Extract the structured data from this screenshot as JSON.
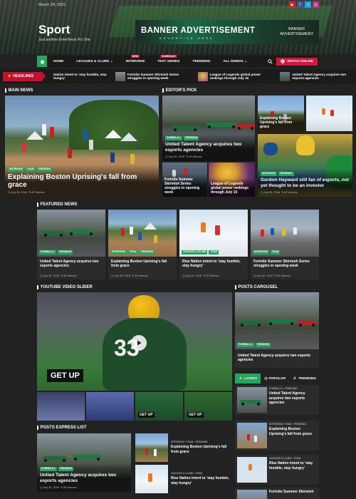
{
  "header": {
    "date": "March 18, 2021",
    "site_title": "Sport",
    "tagline": "Just another EnterNews Pro Site",
    "social_icons": [
      "youtube-icon",
      "facebook-icon",
      "twitter-icon",
      "instagram-icon"
    ],
    "banner": {
      "main_text": "BANNER ADVERTISEMENT",
      "sub_text": "ADVERTISE HERE",
      "side_text_line1": "BANNER",
      "side_text_line2": "ADVERTISEMENT"
    }
  },
  "nav": {
    "items": [
      {
        "label": "HOME",
        "tag": ""
      },
      {
        "label": "LEAGUES & CLUBS ⌄",
        "tag": ""
      },
      {
        "label": "INTERVIEW",
        "tag": "NEW"
      },
      {
        "label": "TEST SERIES",
        "tag": "SCHEDULE"
      },
      {
        "label": "TRENDING",
        "tag": ""
      },
      {
        "label": "ALL DEMOS ⌄",
        "tag": ""
      }
    ],
    "watch_online": "WATCH ONLINE"
  },
  "ticker": {
    "label": "HEADLINES",
    "items": [
      "Nation intent to 'stay humble, stay hungry'",
      "Fortnite Summer Skirmish Series struggles in opening week",
      "League of Legends global power rankings through July 16",
      "United Talent Agency acquires two esports agencies"
    ]
  },
  "main_news": {
    "heading": "MAIN NEWS",
    "categories": [
      "INTERVIEW",
      "TEAM",
      "TRENDING"
    ],
    "title": "Explaining Boston Uprising's fall from grace",
    "date": "July 30, 2018",
    "author": "AF themes"
  },
  "editors_pick": {
    "heading": "EDITOR'S PICK",
    "large": {
      "categories": [
        "FORMULA 1",
        "TRENDING"
      ],
      "title": "United Talent Agency acquires two esports agencies",
      "date": "July 30, 2018",
      "author": "AF themes"
    },
    "small": [
      {
        "title": "Explaining Boston Uprising's fall from grace"
      },
      {
        "title": "Fortnite Summer Skirmish Series struggles in opening week"
      },
      {
        "title": "League of Legends global power rankings through July 16"
      }
    ],
    "tall": {
      "categories": [
        "INTERVIEW",
        "TRENDING"
      ],
      "title": "Gordon Hayward still fan of esports, not yet thought to be an investor",
      "date": "July 30, 2018",
      "author": "AF themes"
    }
  },
  "featured_news": {
    "heading": "FEATURED NEWS",
    "items": [
      {
        "categories": [
          "FORMULA 1",
          "TRENDING"
        ],
        "title": "United Talent Agency acquires two esports agencies",
        "date": "July 30, 2018",
        "author": "AF themes"
      },
      {
        "categories": [
          "INTERVIEW",
          "TEAM",
          "TRENDING"
        ],
        "title": "Explaining Boston Uprising's fall from grace",
        "date": "July 30, 2018",
        "author": "AF themes"
      },
      {
        "categories": [
          "LEAGUES & CLUBS",
          "TEAM"
        ],
        "title": "Rise Nation intent to 'stay humble, stay hungry'",
        "date": "July 30, 2018",
        "author": "AF themes"
      },
      {
        "categories": [
          "INTERVIEW",
          "TEAM"
        ],
        "title": "Fortnite Summer Skirmish Series struggles in opening week",
        "date": "July 30, 2018",
        "author": "AF themes"
      }
    ]
  },
  "video_slider": {
    "heading": "YOUTUBE VIDEO SLIDER",
    "overlay_text": "GET UP",
    "thumb_texts": [
      "",
      "",
      "GET UP",
      "GET UP"
    ]
  },
  "posts_carousel": {
    "heading": "POSTS CAROUSEL",
    "categories": [
      "FORMULA 1",
      "TRENDING"
    ],
    "title": "United Talent Agency acquires two esports agencies"
  },
  "sidebar_tabs": {
    "tabs": [
      "LATEST",
      "POPULAR",
      "TRENDING"
    ],
    "items": [
      {
        "categories": "FORMULA 1 • TRENDING",
        "title": "United Talent Agency acquires two esports agencies"
      },
      {
        "categories": "INTERVIEW • TEAM • TRENDING",
        "title": "Explaining Boston Uprising's fall from grace"
      },
      {
        "categories": "LEAGUES & CLUBS • TEAM",
        "title": "Rise Nation intent to 'stay humble, stay hungry'"
      },
      {
        "categories": "",
        "title": "Fortnite Summer Skirmish"
      }
    ]
  },
  "express_list": {
    "heading": "POSTS EXPRESS LIST",
    "main": {
      "categories": [
        "FORMULA 1",
        "TRENDING"
      ],
      "title": "United Talent Agency acquires two esports agencies",
      "date": "July 30, 2018",
      "author": "AF themes"
    },
    "items": [
      {
        "categories": "INTERVIEW • TEAM • TRENDING",
        "title": "Explaining Boston Uprising's fall from grace"
      },
      {
        "categories": "LEAGUES & CLUBS • TEAM",
        "title": "Rise Nation intent to 'stay humble, stay hungry'"
      }
    ]
  },
  "colors": {
    "accent": "#25a55f",
    "alert": "#c8102e",
    "background": "#222222"
  }
}
